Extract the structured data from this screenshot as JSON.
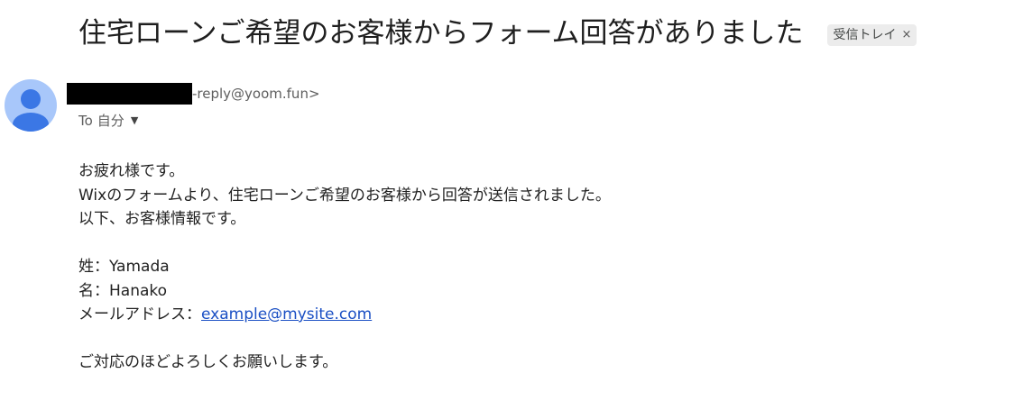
{
  "email": {
    "subject": "住宅ローンご希望のお客様からフォーム回答がありました",
    "label": {
      "text": "受信トレイ",
      "close": "×"
    },
    "sender": {
      "email_visible": "-reply@yoom.fun>"
    },
    "recipient": {
      "prefix": "To",
      "name": "自分",
      "caret": "▼"
    },
    "body": {
      "greeting": "お疲れ様です。",
      "line1": "Wixのフォームより、住宅ローンご希望のお客様から回答が送信されました。",
      "line2": "以下、お客様情報です。",
      "field_last_label": "姓：",
      "field_last_value": "Yamada",
      "field_first_label": "名：",
      "field_first_value": "Hanako",
      "field_email_label": "メールアドレス：",
      "field_email_value": "example@mysite.com",
      "closing": "ご対応のほどよろしくお願いします。"
    }
  },
  "colors": {
    "avatar_bg": "#a8c7fa",
    "avatar_fg": "#3b77e5",
    "link": "#1a4fc4",
    "chip_bg": "#ececec"
  },
  "icons": {
    "avatar": "person-icon",
    "caret": "chevron-down-icon"
  }
}
